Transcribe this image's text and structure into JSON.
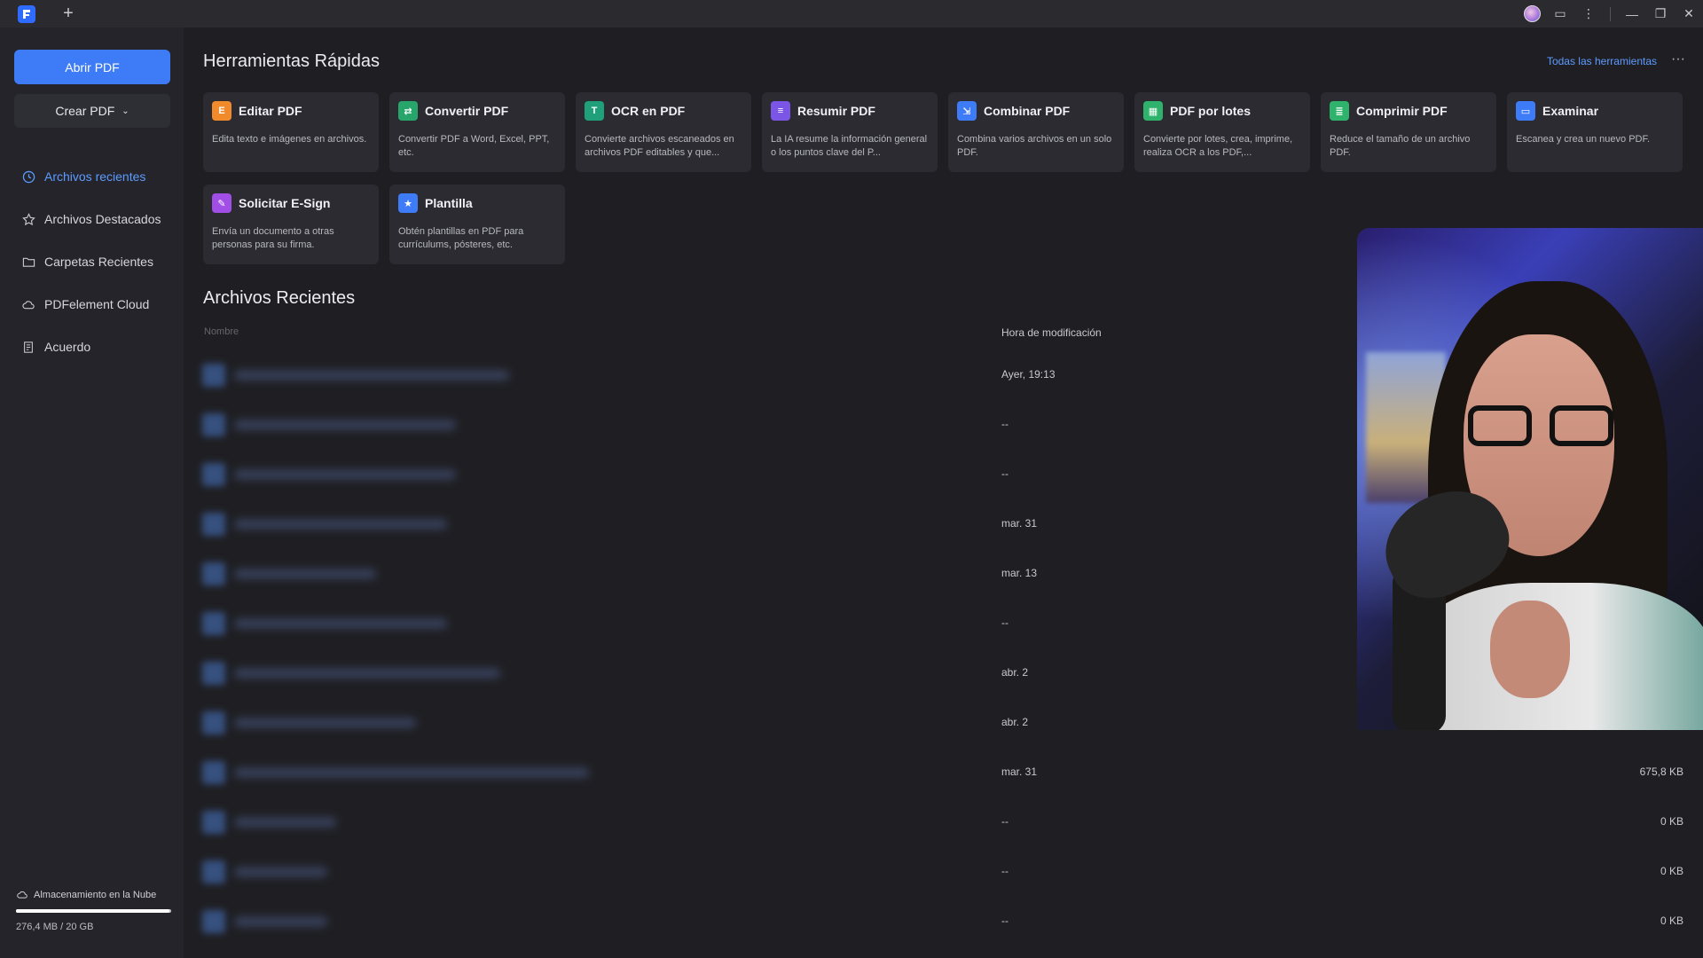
{
  "titlebar": {
    "new_tab": "+",
    "controls": {
      "minimize": "—",
      "restore": "❐",
      "close": "✕",
      "more": "⋮",
      "chat": "▭"
    }
  },
  "sidebar": {
    "open_button": "Abrir PDF",
    "create_button": "Crear PDF",
    "items": [
      {
        "label": "Archivos recientes",
        "icon": "clock-icon",
        "active": true
      },
      {
        "label": "Archivos Destacados",
        "icon": "star-icon",
        "active": false
      },
      {
        "label": "Carpetas Recientes",
        "icon": "folder-icon",
        "active": false
      },
      {
        "label": "PDFelement Cloud",
        "icon": "cloud-icon",
        "active": false
      },
      {
        "label": "Acuerdo",
        "icon": "document-icon",
        "active": false
      }
    ],
    "storage": {
      "label": "Almacenamiento en la Nube",
      "usage": "276,4 MB / 20 GB",
      "fill_fraction": 0.99
    }
  },
  "quick_tools": {
    "title": "Herramientas Rápidas",
    "all_tools_link": "Todas las herramientas",
    "more": "···",
    "tools": [
      {
        "title": "Editar PDF",
        "desc": "Edita texto e imágenes en archivos.",
        "color": "#f08a2b",
        "glyph": "E"
      },
      {
        "title": "Convertir PDF",
        "desc": "Convertir PDF a Word, Excel, PPT, etc.",
        "color": "#27a56b",
        "glyph": "⇄"
      },
      {
        "title": "OCR en PDF",
        "desc": "Convierte archivos escaneados en archivos PDF editables y que...",
        "color": "#1fa07a",
        "glyph": "T"
      },
      {
        "title": "Resumir PDF",
        "desc": "La IA resume la información general o los puntos clave del P...",
        "color": "#7a55e6",
        "glyph": "≡"
      },
      {
        "title": "Combinar PDF",
        "desc": "Combina varios archivos en un solo PDF.",
        "color": "#3e7cf7",
        "glyph": "⇲"
      },
      {
        "title": "PDF por lotes",
        "desc": "Convierte por lotes, crea, imprime, realiza OCR a los PDF,...",
        "color": "#2fb36c",
        "glyph": "▦"
      },
      {
        "title": "Comprimir PDF",
        "desc": "Reduce el tamaño de un archivo PDF.",
        "color": "#2fb36c",
        "glyph": "≣"
      },
      {
        "title": "Examinar",
        "desc": "Escanea y crea un nuevo PDF.",
        "color": "#3e7cf7",
        "glyph": "▭"
      },
      {
        "title": "Solicitar E-Sign",
        "desc": "Envía un documento a otras personas para su firma.",
        "color": "#a04ee6",
        "glyph": "✎"
      },
      {
        "title": "Plantilla",
        "desc": "Obtén plantillas en PDF para currículums, pósteres, etc.",
        "color": "#3e7cf7",
        "glyph": "★"
      }
    ]
  },
  "recent_files": {
    "title": "Archivos Recientes",
    "columns": {
      "name": "Nombre",
      "time": "Hora de modificación"
    },
    "rows": [
      {
        "time": "Ayer, 19:13",
        "size": ""
      },
      {
        "time": "--",
        "size": ""
      },
      {
        "time": "--",
        "size": ""
      },
      {
        "time": "mar. 31",
        "size": ""
      },
      {
        "time": "mar. 13",
        "size": ""
      },
      {
        "time": "--",
        "size": ""
      },
      {
        "time": "abr. 2",
        "size": ""
      },
      {
        "time": "abr. 2",
        "size": ""
      },
      {
        "time": "mar. 31",
        "size": "675,8 KB"
      },
      {
        "time": "--",
        "size": "0 KB"
      },
      {
        "time": "--",
        "size": "0 KB"
      },
      {
        "time": "--",
        "size": "0 KB"
      }
    ]
  }
}
